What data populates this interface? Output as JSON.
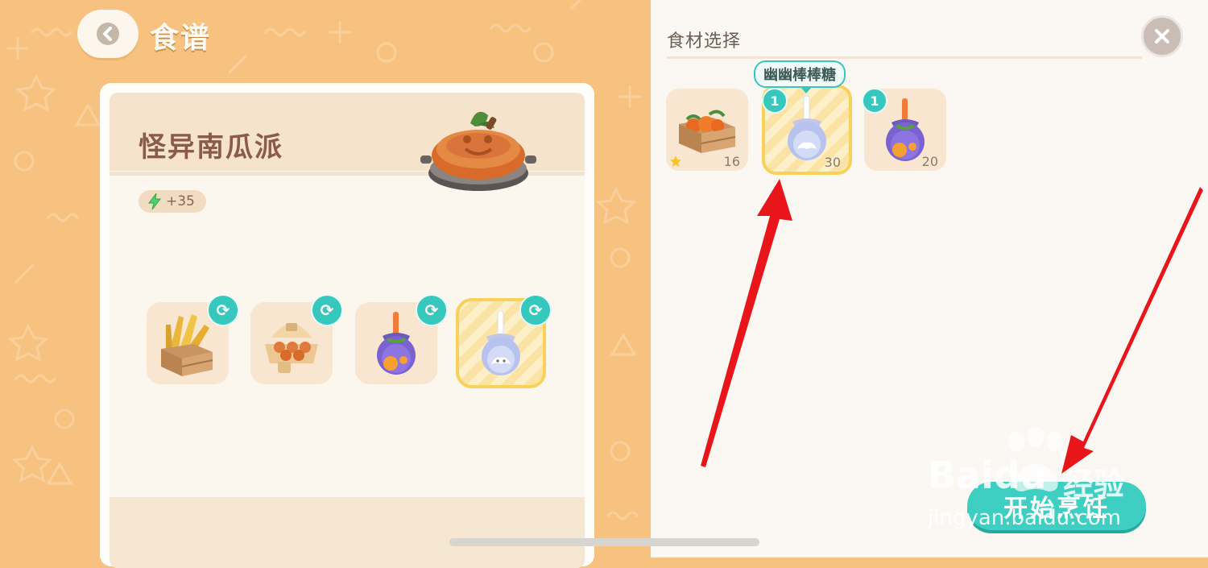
{
  "header": {
    "title": "食谱"
  },
  "recipe": {
    "name": "怪异南瓜派",
    "energy": "+35",
    "ingredients": [
      {
        "icon": "wheat-crate-icon"
      },
      {
        "icon": "egg-carton-icon"
      },
      {
        "icon": "pumpkin-candy-icon"
      },
      {
        "icon": "ghost-candy-icon",
        "selected": true
      }
    ]
  },
  "panel": {
    "title": "食材选择",
    "tooltip": "幽幽棒棒糖",
    "items": [
      {
        "icon": "pumpkin-crate-icon",
        "qty": "16",
        "starred": true
      },
      {
        "icon": "ghost-candy-icon",
        "qty": "30",
        "badge": "1",
        "selected": true
      },
      {
        "icon": "pumpkin-candy-icon",
        "qty": "20",
        "badge": "1"
      }
    ],
    "start_label": "开始烹饪"
  },
  "watermark": {
    "brand": "Baidu",
    "brand_cn": "经验",
    "url": "jingyan.baidu.com"
  },
  "colors": {
    "accent": "#36c7bd",
    "background": "#f7c27f",
    "arrow": "#e8161b"
  }
}
